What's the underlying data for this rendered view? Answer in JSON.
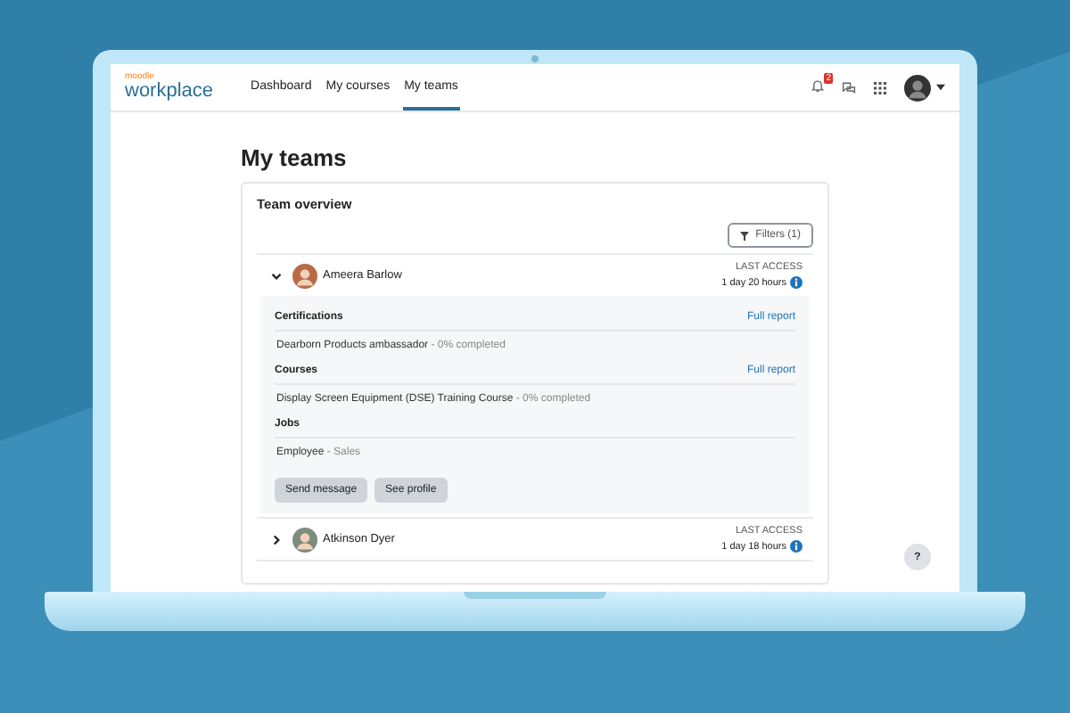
{
  "nav": {
    "logo_small": "moodle",
    "logo": "workplace",
    "links": [
      {
        "label": "Dashboard",
        "selected": false
      },
      {
        "label": "My courses",
        "selected": false
      },
      {
        "label": "My teams",
        "selected": true
      }
    ],
    "notification_count": "2"
  },
  "page_title": "My teams",
  "card": {
    "title": "Team overview",
    "filter": "Filters (1)",
    "members": [
      {
        "name": "Ameera Barlow",
        "expanded": true,
        "access_label": "LAST ACCESS",
        "access": "1 day 20 hours",
        "sections": [
          {
            "heading": "Certifications",
            "link": "Full report",
            "items": [
              {
                "text": "Dearborn Products ambassador",
                "detail": "- 0% completed"
              }
            ]
          },
          {
            "heading": "Courses",
            "link": "Full report",
            "items": [
              {
                "text": "Display Screen Equipment (DSE) Training Course",
                "detail": "- 0% completed"
              }
            ]
          },
          {
            "heading": "Jobs",
            "items": [
              {
                "text": "Employee",
                "detail": "- Sales"
              }
            ]
          }
        ],
        "buttons": [
          "Send message",
          "See profile"
        ]
      },
      {
        "name": "Atkinson Dyer",
        "expanded": false,
        "access_label": "LAST ACCESS",
        "access": "1 day 18 hours"
      }
    ]
  },
  "help": "?"
}
